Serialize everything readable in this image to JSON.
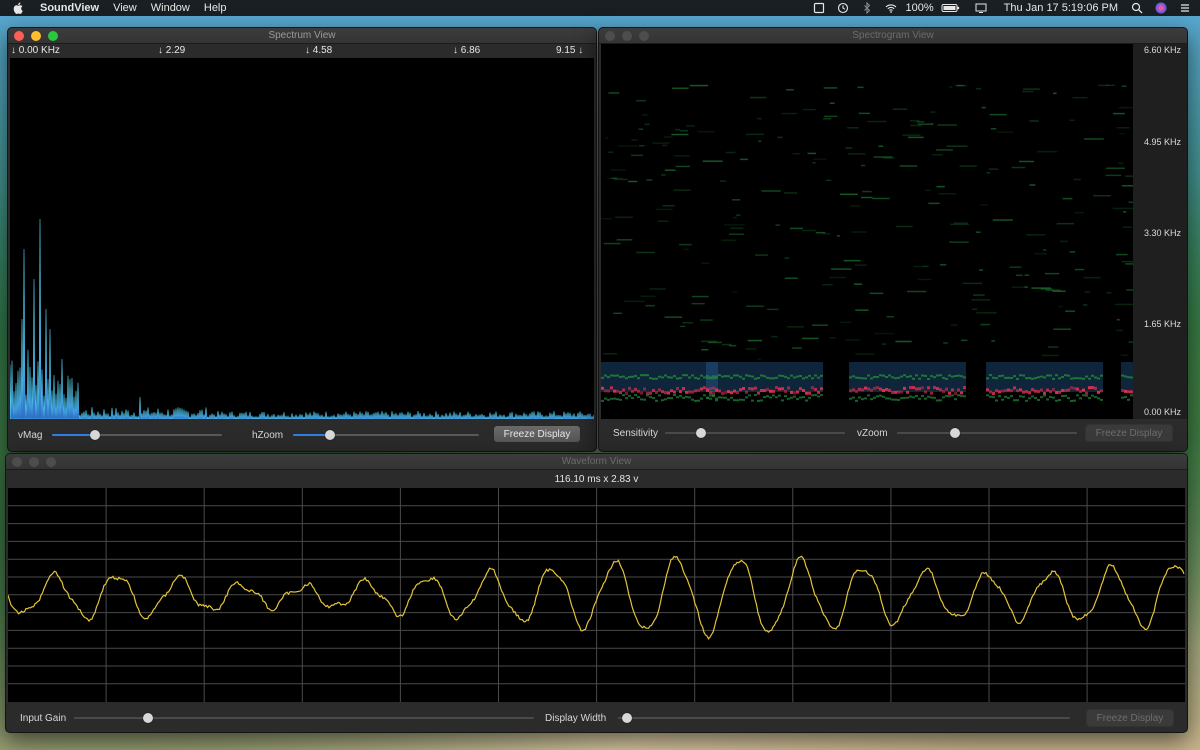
{
  "menubar": {
    "app_name": "SoundView",
    "menus": [
      "View",
      "Window",
      "Help"
    ],
    "battery": "100%",
    "clock": "Thu Jan 17  5:19:06 PM",
    "status_icons": [
      "screen-record-icon",
      "time-machine-icon",
      "bluetooth-icon",
      "wifi-icon",
      "battery-icon",
      "display-icon",
      "search-icon",
      "user-icon",
      "list-icon"
    ]
  },
  "spectrum": {
    "title": "Spectrum View",
    "axis_labels": [
      "↓ 0.00 KHz",
      "↓ 2.29",
      "↓ 4.58",
      "↓ 6.86",
      "9.15 ↓"
    ],
    "vmag_label": "vMag",
    "vmag_value": 0.25,
    "hzoom_label": "hZoom",
    "hzoom_value": 0.2,
    "freeze_label": "Freeze Display",
    "colors": {
      "bar_light": "#55d7f5",
      "bar_dark": "#1d3fb3"
    }
  },
  "spectrogram": {
    "title": "Spectrogram View",
    "freq_labels": [
      "6.60 KHz",
      "4.95 KHz",
      "3.30 KHz",
      "1.65 KHz",
      "0.00 KHz"
    ],
    "sensitivity_label": "Sensitivity",
    "sensitivity_value": 0.2,
    "vzoom_label": "vZoom",
    "vzoom_value": 0.32,
    "freeze_label": "Freeze Display",
    "colors": {
      "band_green": "#1f8a3a",
      "band_red": "#e0304f",
      "band_blue": "#2a6aa8"
    }
  },
  "waveform": {
    "title": "Waveform View",
    "info": "116.10 ms x 2.83 v",
    "input_gain_label": "Input Gain",
    "input_gain_value": 0.16,
    "display_width_label": "Display Width",
    "display_width_value": 0.02,
    "freeze_label": "Freeze Display",
    "colors": {
      "trace": "#e3c43a",
      "grid": "#4a4a4a"
    }
  }
}
